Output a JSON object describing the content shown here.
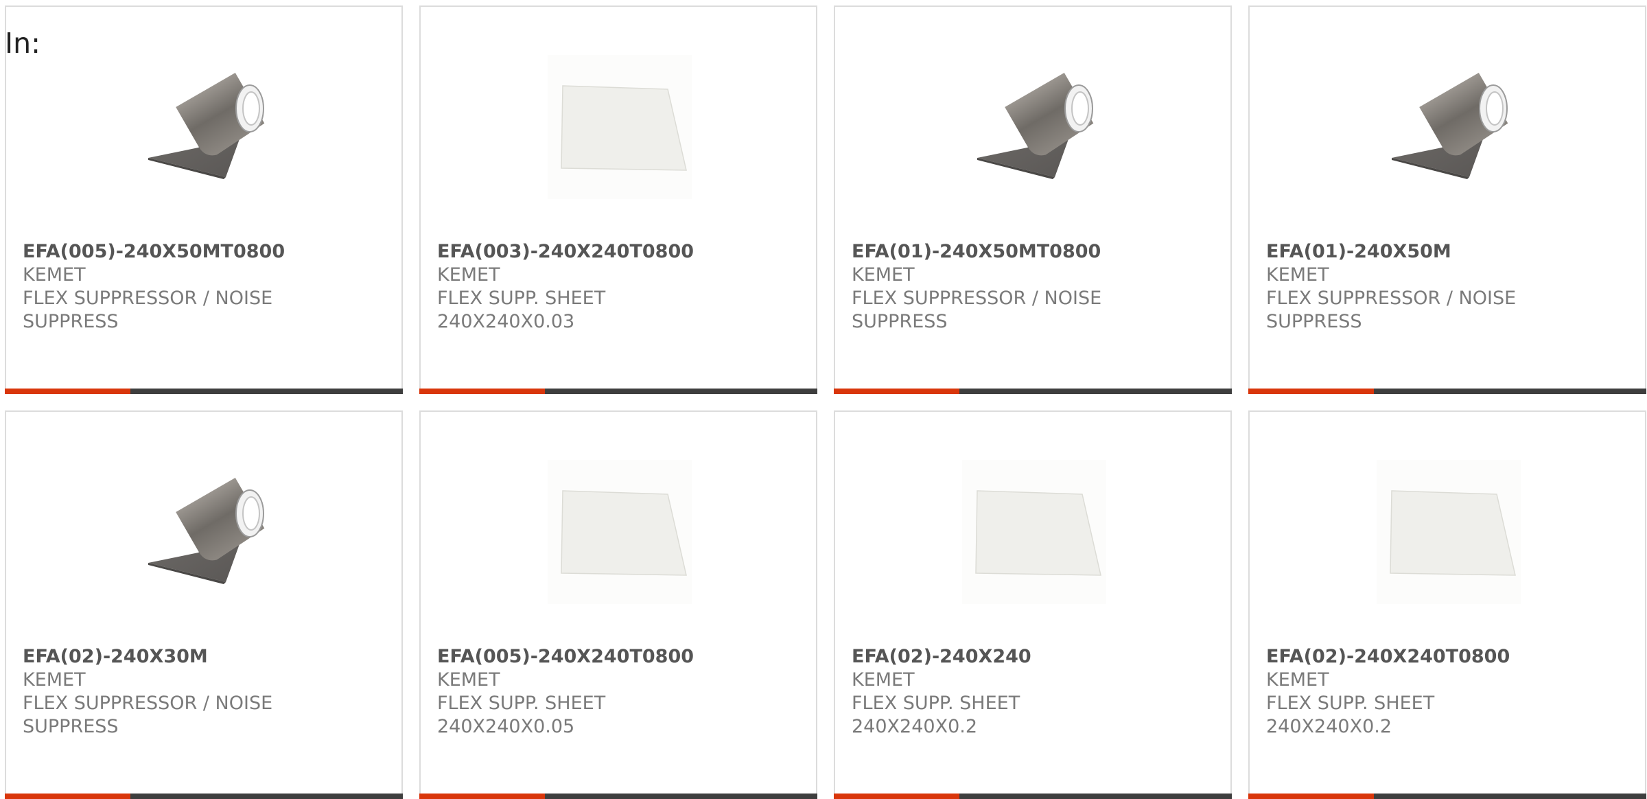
{
  "header": {
    "label": "In:"
  },
  "colors": {
    "accent": "#d9360b",
    "bar": "#3e3e3e",
    "border": "#dcdcdc"
  },
  "products": [
    {
      "part": "EFA(005)-240X50MT0800",
      "maker": "KEMET",
      "desc": "FLEX SUPPRESSOR / NOISE SUPPRESS",
      "image": "roll-icon"
    },
    {
      "part": "EFA(003)-240X240T0800",
      "maker": "KEMET",
      "desc": "FLEX SUPP. SHEET 240X240X0.03",
      "image": "sheet-icon"
    },
    {
      "part": "EFA(01)-240X50MT0800",
      "maker": "KEMET",
      "desc": "FLEX SUPPRESSOR / NOISE SUPPRESS",
      "image": "roll-icon"
    },
    {
      "part": "EFA(01)-240X50M",
      "maker": "KEMET",
      "desc": "FLEX SUPPRESSOR / NOISE SUPPRESS",
      "image": "roll-icon"
    },
    {
      "part": "EFA(02)-240X30M",
      "maker": "KEMET",
      "desc": "FLEX SUPPRESSOR / NOISE SUPPRESS",
      "image": "roll-icon"
    },
    {
      "part": "EFA(005)-240X240T0800",
      "maker": "KEMET",
      "desc": "FLEX SUPP. SHEET 240X240X0.05",
      "image": "sheet-icon"
    },
    {
      "part": "EFA(02)-240X240",
      "maker": "KEMET",
      "desc": "FLEX SUPP. SHEET 240X240X0.2",
      "image": "sheet-icon"
    },
    {
      "part": "EFA(02)-240X240T0800",
      "maker": "KEMET",
      "desc": "FLEX SUPP. SHEET 240X240X0.2",
      "image": "sheet-icon"
    }
  ]
}
